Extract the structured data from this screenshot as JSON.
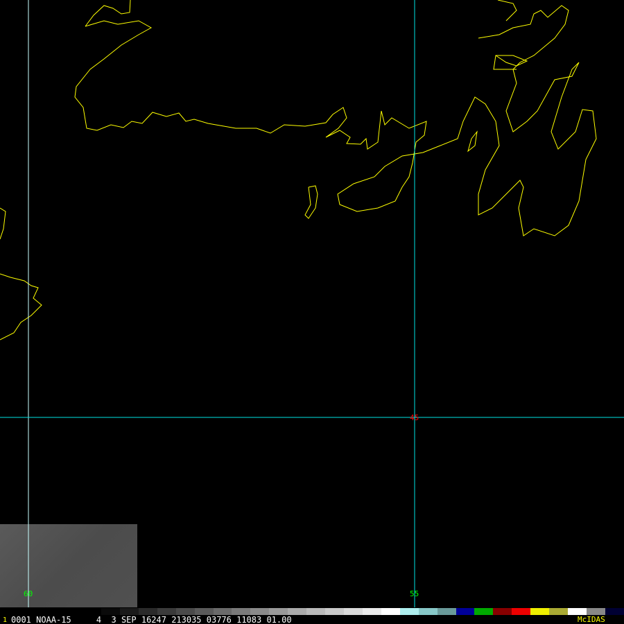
{
  "grid": {
    "lon_labels": [
      "60",
      "55"
    ],
    "lat_labels": [
      "45"
    ],
    "grid_color": "#00e5e5",
    "lon_label_color": "#00ff00",
    "lat_label_color": "#ff0000",
    "coast_color": "#ffff00"
  },
  "footer": {
    "frame_marker": "1",
    "status_line": "0001 NOAA-15     4  3 SEP 16247 213035 03776 11083 01.00",
    "brand": "McIDAS"
  },
  "color_ramp": [
    "#0a0a0a",
    "#1a1a1a",
    "#2a2a2a",
    "#3a3a3a",
    "#4a4a4a",
    "#5a5a5a",
    "#6a6a6a",
    "#7a7a7a",
    "#8a8a8a",
    "#9a9a9a",
    "#aaaaaa",
    "#bababa",
    "#cacaca",
    "#dadada",
    "#eaeaea",
    "#ffffff",
    "#aeeeee",
    "#88c8c8",
    "#6a9a9a",
    "#000099",
    "#00aa00",
    "#880000",
    "#ee0000",
    "#eeee00",
    "#aaaa33",
    "#ffffff",
    "#888888",
    "#000033"
  ]
}
